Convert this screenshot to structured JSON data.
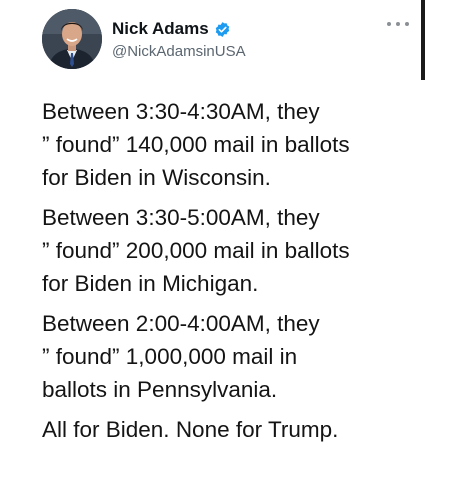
{
  "author": {
    "display_name": "Nick Adams",
    "handle": "@NickAdamsinUSA",
    "verified": true,
    "verified_icon": "verified-badge-icon",
    "avatar": "profile-photo-avatar"
  },
  "menu": {
    "icon": "more-options-icon"
  },
  "tweet": {
    "paragraphs": [
      "Between 3:30-4:30AM, they\n” found” 140,000 mail in ballots\nfor Biden in Wisconsin.",
      "Between 3:30-5:00AM, they\n” found” 200,000 mail in ballots\nfor Biden in Michigan.",
      "Between 2:00-4:00AM, they\n” found” 1,000,000 mail in\nballots in Pennsylvania.",
      "All for Biden. None for Trump."
    ]
  },
  "colors": {
    "verified_blue": "#1d9bf0",
    "text": "#141414",
    "handle_gray": "#5b6670"
  }
}
